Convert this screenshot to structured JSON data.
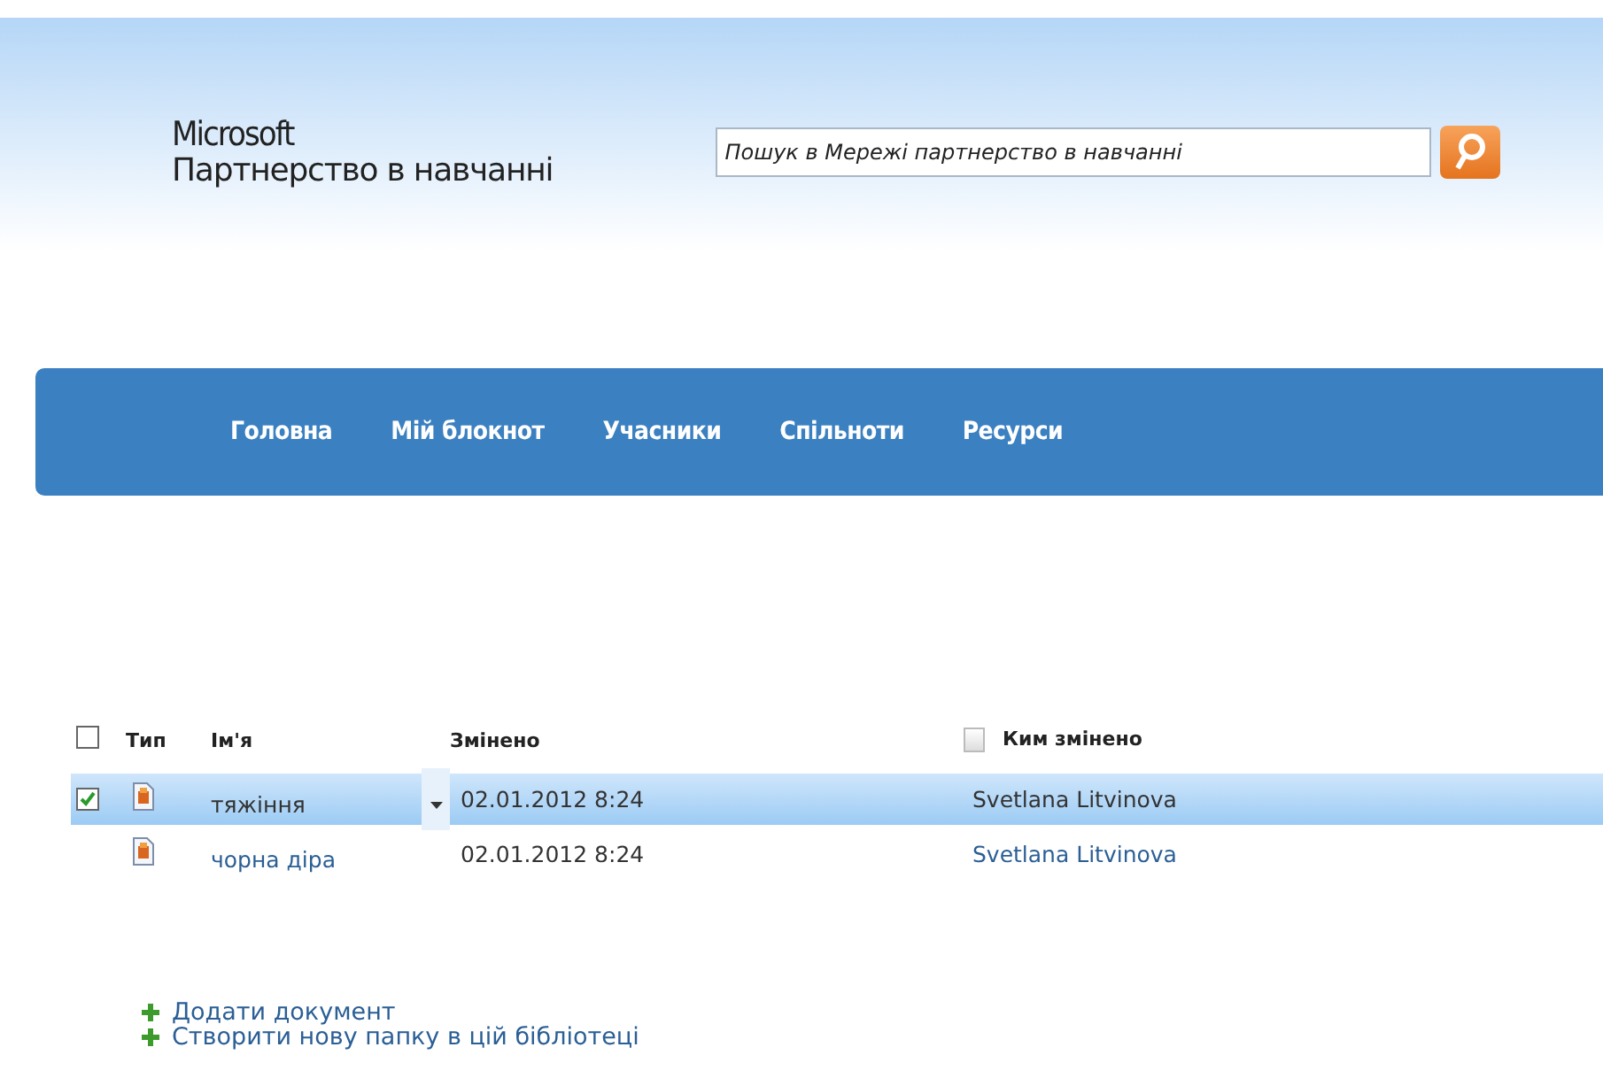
{
  "header": {
    "logo_brand": "Microsoft",
    "logo_title": "Партнерство в навчанні",
    "search": {
      "placeholder": "Пошук в Мережі партнерство в навчанні"
    }
  },
  "nav": {
    "items": [
      {
        "label": "Головна"
      },
      {
        "label": "Мій блокнот"
      },
      {
        "label": "Учасники"
      },
      {
        "label": "Спільноти"
      },
      {
        "label": "Ресурси"
      }
    ]
  },
  "table": {
    "select_all": {
      "checked": false
    },
    "columns": [
      "Тип",
      "Ім'я",
      "Змінено",
      "Ким змінено"
    ],
    "rows": [
      {
        "selected": true,
        "checked": true,
        "name": "тяжіння",
        "modified": "02.01.2012 8:24",
        "modified_by": "Svetlana Litvinova"
      },
      {
        "selected": false,
        "checked": false,
        "name": "чорна діра",
        "modified": "02.01.2012 8:24",
        "modified_by": "Svetlana Litvinova"
      }
    ]
  },
  "actions": [
    "Додати документ",
    "Створити нову папку в цій бібліотеці"
  ]
}
